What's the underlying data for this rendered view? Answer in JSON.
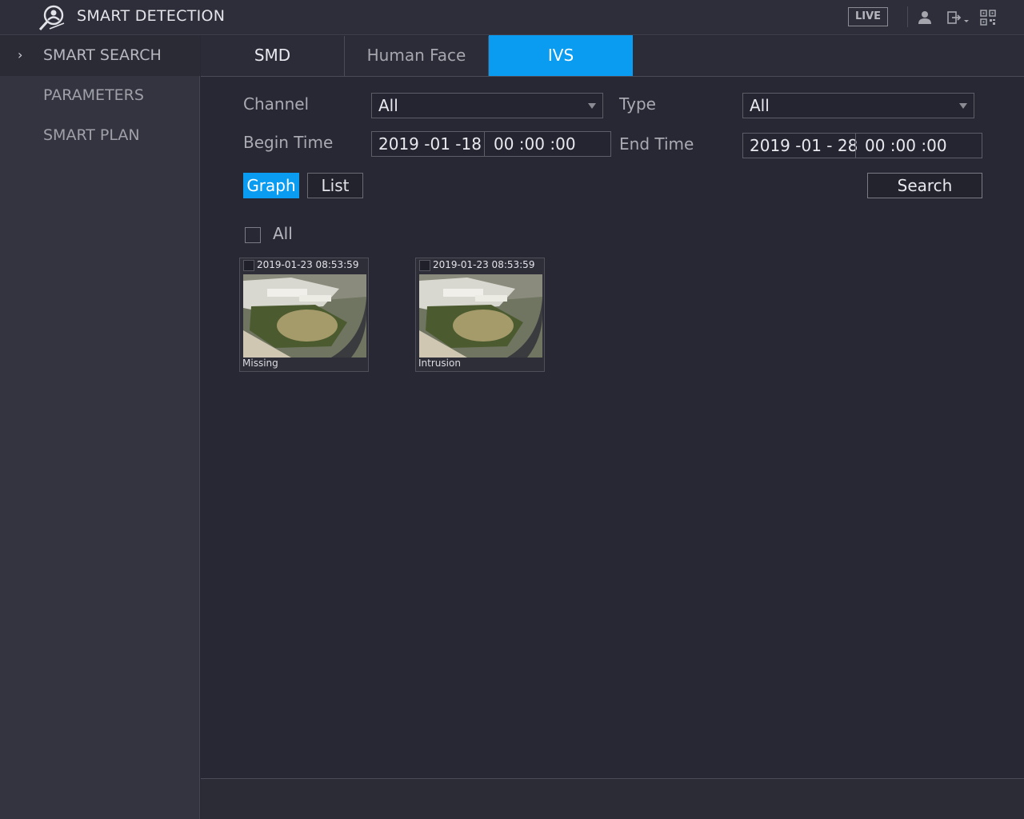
{
  "header": {
    "title": "SMART DETECTION",
    "live_label": "LIVE",
    "icons": [
      "smart-detection-logo",
      "user-icon",
      "logout-icon",
      "qr-code-icon"
    ]
  },
  "sidebar": {
    "items": [
      {
        "label": "SMART SEARCH",
        "active": true
      },
      {
        "label": "PARAMETERS",
        "active": false
      },
      {
        "label": "SMART PLAN",
        "active": false
      }
    ]
  },
  "tabs": [
    {
      "label": "SMD",
      "active": false
    },
    {
      "label": "Human Face",
      "active": false
    },
    {
      "label": "IVS",
      "active": true
    }
  ],
  "form": {
    "channel_label": "Channel",
    "channel_value": "All",
    "type_label": "Type",
    "type_value": "All",
    "begin_label": "Begin Time",
    "begin_date": "2019 -01 -18",
    "begin_time": "00 :00 :00",
    "end_label": "End Time",
    "end_date": "2019 -01 - 28",
    "end_time": "00 :00 :00"
  },
  "view": {
    "graph_label": "Graph",
    "list_label": "List",
    "active": "Graph",
    "search_label": "Search",
    "select_all_label": "All"
  },
  "results": [
    {
      "time": "2019-01-23 08:53:59",
      "type": "Missing"
    },
    {
      "time": "2019-01-23 08:53:59",
      "type": "Intrusion"
    }
  ],
  "colors": {
    "accent": "#0a9cf1",
    "background": "#272833",
    "sidebar": "#33343f"
  }
}
